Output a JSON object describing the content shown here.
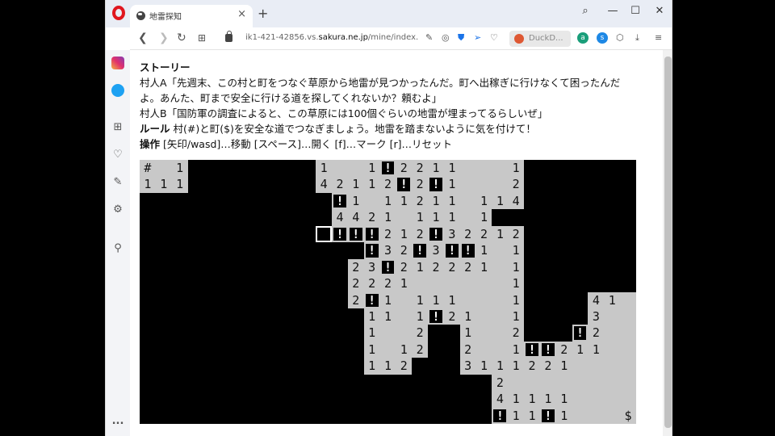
{
  "browser": {
    "tab_title": "地雷探知",
    "tab_close": "×",
    "new_tab": "+",
    "url_prefix": "ik1-421-42856.vs.",
    "url_domain": "sakura.ne.jp",
    "url_path": "/mine/index.htm",
    "search_engine_label": "DuckD...",
    "window_controls": {
      "search": "⌕",
      "minimize": "—",
      "maximize": "☐",
      "close": "✕"
    }
  },
  "sidebar": {
    "icons": [
      "instagram-icon",
      "twitter-icon",
      "apps-icon",
      "heart-icon",
      "pinboard-icon",
      "settings-icon",
      "lightbulb-icon",
      "more-icon"
    ],
    "more_label": "..."
  },
  "page": {
    "story_heading": "ストーリー",
    "story_line1": "村人A「先週末、この村と町をつなぐ草原から地雷が見つかったんだ。町へ出稼ぎに行けなくて困ったんだ",
    "story_line2": "よ。あんた、町まで安全に行ける道を探してくれないか？頼むよ」",
    "story_line3": "村人B「国防軍の調査によると、この草原には100個ぐらいの地雷が埋まってるらしいぜ」",
    "rules_label": "ルール",
    "rules_text": " 村(#)と町($)を安全な道でつなぎましょう。地雷を踏まないように気を付けて！",
    "controls_label": "操作",
    "controls_text": " [矢印/wasd]…移動 [スペース]…開く [f]…マーク [r]…リセット"
  },
  "board": {
    "columns": 31,
    "rows": 16,
    "legend": {
      "village": "#",
      "town": "$",
      "mine_mark": "!"
    },
    "cursor": {
      "row": 4,
      "col": 11
    },
    "cells": [
      {
        "r": 0,
        "c": 0,
        "v": "#"
      },
      {
        "r": 0,
        "c": 1,
        "v": ""
      },
      {
        "r": 0,
        "c": 2,
        "v": "1"
      },
      {
        "r": 1,
        "c": 0,
        "v": "1"
      },
      {
        "r": 1,
        "c": 1,
        "v": "1"
      },
      {
        "r": 1,
        "c": 2,
        "v": "1"
      },
      {
        "r": 0,
        "c": 11,
        "v": "1"
      },
      {
        "r": 0,
        "c": 12,
        "v": ""
      },
      {
        "r": 0,
        "c": 13,
        "v": ""
      },
      {
        "r": 0,
        "c": 14,
        "v": "1"
      },
      {
        "r": 0,
        "c": 15,
        "v": "!"
      },
      {
        "r": 0,
        "c": 16,
        "v": "2"
      },
      {
        "r": 0,
        "c": 17,
        "v": "2"
      },
      {
        "r": 0,
        "c": 18,
        "v": "1"
      },
      {
        "r": 0,
        "c": 19,
        "v": "1"
      },
      {
        "r": 0,
        "c": 20,
        "v": ""
      },
      {
        "r": 0,
        "c": 21,
        "v": ""
      },
      {
        "r": 0,
        "c": 22,
        "v": ""
      },
      {
        "r": 0,
        "c": 23,
        "v": "1"
      },
      {
        "r": 1,
        "c": 11,
        "v": "4"
      },
      {
        "r": 1,
        "c": 12,
        "v": "2"
      },
      {
        "r": 1,
        "c": 13,
        "v": "1"
      },
      {
        "r": 1,
        "c": 14,
        "v": "1"
      },
      {
        "r": 1,
        "c": 15,
        "v": "2"
      },
      {
        "r": 1,
        "c": 16,
        "v": "!"
      },
      {
        "r": 1,
        "c": 17,
        "v": "2"
      },
      {
        "r": 1,
        "c": 18,
        "v": "!"
      },
      {
        "r": 1,
        "c": 19,
        "v": "1"
      },
      {
        "r": 1,
        "c": 20,
        "v": ""
      },
      {
        "r": 1,
        "c": 21,
        "v": ""
      },
      {
        "r": 1,
        "c": 22,
        "v": ""
      },
      {
        "r": 1,
        "c": 23,
        "v": "2"
      },
      {
        "r": 2,
        "c": 12,
        "v": "!"
      },
      {
        "r": 2,
        "c": 13,
        "v": "1"
      },
      {
        "r": 2,
        "c": 14,
        "v": ""
      },
      {
        "r": 2,
        "c": 15,
        "v": "1"
      },
      {
        "r": 2,
        "c": 16,
        "v": "1"
      },
      {
        "r": 2,
        "c": 17,
        "v": "2"
      },
      {
        "r": 2,
        "c": 18,
        "v": "1"
      },
      {
        "r": 2,
        "c": 19,
        "v": "1"
      },
      {
        "r": 2,
        "c": 20,
        "v": ""
      },
      {
        "r": 2,
        "c": 21,
        "v": "1"
      },
      {
        "r": 2,
        "c": 22,
        "v": "1"
      },
      {
        "r": 2,
        "c": 23,
        "v": "4"
      },
      {
        "r": 3,
        "c": 12,
        "v": "4"
      },
      {
        "r": 3,
        "c": 13,
        "v": "4"
      },
      {
        "r": 3,
        "c": 14,
        "v": "2"
      },
      {
        "r": 3,
        "c": 15,
        "v": "1"
      },
      {
        "r": 3,
        "c": 16,
        "v": ""
      },
      {
        "r": 3,
        "c": 17,
        "v": "1"
      },
      {
        "r": 3,
        "c": 18,
        "v": "1"
      },
      {
        "r": 3,
        "c": 19,
        "v": "1"
      },
      {
        "r": 3,
        "c": 20,
        "v": ""
      },
      {
        "r": 3,
        "c": 21,
        "v": "1"
      },
      {
        "r": 4,
        "c": 12,
        "v": "!"
      },
      {
        "r": 4,
        "c": 13,
        "v": "!"
      },
      {
        "r": 4,
        "c": 14,
        "v": "!"
      },
      {
        "r": 4,
        "c": 15,
        "v": "2"
      },
      {
        "r": 4,
        "c": 16,
        "v": "1"
      },
      {
        "r": 4,
        "c": 17,
        "v": "2"
      },
      {
        "r": 4,
        "c": 18,
        "v": "!"
      },
      {
        "r": 4,
        "c": 19,
        "v": "3"
      },
      {
        "r": 4,
        "c": 20,
        "v": "2"
      },
      {
        "r": 4,
        "c": 21,
        "v": "2"
      },
      {
        "r": 4,
        "c": 22,
        "v": "1"
      },
      {
        "r": 4,
        "c": 23,
        "v": "2"
      },
      {
        "r": 5,
        "c": 14,
        "v": "!"
      },
      {
        "r": 5,
        "c": 15,
        "v": "3"
      },
      {
        "r": 5,
        "c": 16,
        "v": "2"
      },
      {
        "r": 5,
        "c": 17,
        "v": "!"
      },
      {
        "r": 5,
        "c": 18,
        "v": "3"
      },
      {
        "r": 5,
        "c": 19,
        "v": "!"
      },
      {
        "r": 5,
        "c": 20,
        "v": "!"
      },
      {
        "r": 5,
        "c": 21,
        "v": "1"
      },
      {
        "r": 5,
        "c": 22,
        "v": ""
      },
      {
        "r": 5,
        "c": 23,
        "v": "1"
      },
      {
        "r": 6,
        "c": 13,
        "v": "2"
      },
      {
        "r": 6,
        "c": 14,
        "v": "3"
      },
      {
        "r": 6,
        "c": 15,
        "v": "!"
      },
      {
        "r": 6,
        "c": 16,
        "v": "2"
      },
      {
        "r": 6,
        "c": 17,
        "v": "1"
      },
      {
        "r": 6,
        "c": 18,
        "v": "2"
      },
      {
        "r": 6,
        "c": 19,
        "v": "2"
      },
      {
        "r": 6,
        "c": 20,
        "v": "2"
      },
      {
        "r": 6,
        "c": 21,
        "v": "1"
      },
      {
        "r": 6,
        "c": 22,
        "v": ""
      },
      {
        "r": 6,
        "c": 23,
        "v": "1"
      },
      {
        "r": 7,
        "c": 13,
        "v": "2"
      },
      {
        "r": 7,
        "c": 14,
        "v": "2"
      },
      {
        "r": 7,
        "c": 15,
        "v": "2"
      },
      {
        "r": 7,
        "c": 16,
        "v": "1"
      },
      {
        "r": 7,
        "c": 17,
        "v": ""
      },
      {
        "r": 7,
        "c": 18,
        "v": ""
      },
      {
        "r": 7,
        "c": 19,
        "v": ""
      },
      {
        "r": 7,
        "c": 20,
        "v": ""
      },
      {
        "r": 7,
        "c": 21,
        "v": ""
      },
      {
        "r": 7,
        "c": 22,
        "v": ""
      },
      {
        "r": 7,
        "c": 23,
        "v": "1"
      },
      {
        "r": 8,
        "c": 13,
        "v": "2"
      },
      {
        "r": 8,
        "c": 14,
        "v": "!"
      },
      {
        "r": 8,
        "c": 15,
        "v": "1"
      },
      {
        "r": 8,
        "c": 16,
        "v": ""
      },
      {
        "r": 8,
        "c": 17,
        "v": "1"
      },
      {
        "r": 8,
        "c": 18,
        "v": "1"
      },
      {
        "r": 8,
        "c": 19,
        "v": "1"
      },
      {
        "r": 8,
        "c": 20,
        "v": ""
      },
      {
        "r": 8,
        "c": 21,
        "v": ""
      },
      {
        "r": 8,
        "c": 22,
        "v": ""
      },
      {
        "r": 8,
        "c": 23,
        "v": "1"
      },
      {
        "r": 8,
        "c": 28,
        "v": "4"
      },
      {
        "r": 8,
        "c": 29,
        "v": "1"
      },
      {
        "r": 8,
        "c": 30,
        "v": ""
      },
      {
        "r": 9,
        "c": 14,
        "v": "1"
      },
      {
        "r": 9,
        "c": 15,
        "v": "1"
      },
      {
        "r": 9,
        "c": 16,
        "v": ""
      },
      {
        "r": 9,
        "c": 17,
        "v": "1"
      },
      {
        "r": 9,
        "c": 18,
        "v": "!"
      },
      {
        "r": 9,
        "c": 19,
        "v": "2"
      },
      {
        "r": 9,
        "c": 20,
        "v": "1"
      },
      {
        "r": 9,
        "c": 21,
        "v": ""
      },
      {
        "r": 9,
        "c": 22,
        "v": ""
      },
      {
        "r": 9,
        "c": 23,
        "v": "1"
      },
      {
        "r": 9,
        "c": 28,
        "v": "3"
      },
      {
        "r": 9,
        "c": 29,
        "v": ""
      },
      {
        "r": 9,
        "c": 30,
        "v": ""
      },
      {
        "r": 10,
        "c": 14,
        "v": "1"
      },
      {
        "r": 10,
        "c": 15,
        "v": ""
      },
      {
        "r": 10,
        "c": 16,
        "v": ""
      },
      {
        "r": 10,
        "c": 17,
        "v": "2"
      },
      {
        "r": 10,
        "c": 20,
        "v": "1"
      },
      {
        "r": 10,
        "c": 21,
        "v": ""
      },
      {
        "r": 10,
        "c": 22,
        "v": ""
      },
      {
        "r": 10,
        "c": 23,
        "v": "2"
      },
      {
        "r": 10,
        "c": 27,
        "v": "!"
      },
      {
        "r": 10,
        "c": 28,
        "v": "2"
      },
      {
        "r": 10,
        "c": 29,
        "v": ""
      },
      {
        "r": 10,
        "c": 30,
        "v": ""
      },
      {
        "r": 11,
        "c": 14,
        "v": "1"
      },
      {
        "r": 11,
        "c": 15,
        "v": ""
      },
      {
        "r": 11,
        "c": 16,
        "v": "1"
      },
      {
        "r": 11,
        "c": 17,
        "v": "2"
      },
      {
        "r": 11,
        "c": 20,
        "v": "2"
      },
      {
        "r": 11,
        "c": 21,
        "v": ""
      },
      {
        "r": 11,
        "c": 22,
        "v": ""
      },
      {
        "r": 11,
        "c": 23,
        "v": "1"
      },
      {
        "r": 11,
        "c": 24,
        "v": "!"
      },
      {
        "r": 11,
        "c": 25,
        "v": "!"
      },
      {
        "r": 11,
        "c": 26,
        "v": "2"
      },
      {
        "r": 11,
        "c": 27,
        "v": "1"
      },
      {
        "r": 11,
        "c": 28,
        "v": "1"
      },
      {
        "r": 11,
        "c": 29,
        "v": ""
      },
      {
        "r": 11,
        "c": 30,
        "v": ""
      },
      {
        "r": 12,
        "c": 14,
        "v": "1"
      },
      {
        "r": 12,
        "c": 15,
        "v": "1"
      },
      {
        "r": 12,
        "c": 16,
        "v": "2"
      },
      {
        "r": 12,
        "c": 20,
        "v": "3"
      },
      {
        "r": 12,
        "c": 21,
        "v": "1"
      },
      {
        "r": 12,
        "c": 22,
        "v": "1"
      },
      {
        "r": 12,
        "c": 23,
        "v": "1"
      },
      {
        "r": 12,
        "c": 24,
        "v": "2"
      },
      {
        "r": 12,
        "c": 25,
        "v": "2"
      },
      {
        "r": 12,
        "c": 26,
        "v": "1"
      },
      {
        "r": 12,
        "c": 27,
        "v": ""
      },
      {
        "r": 12,
        "c": 28,
        "v": ""
      },
      {
        "r": 12,
        "c": 29,
        "v": ""
      },
      {
        "r": 12,
        "c": 30,
        "v": ""
      },
      {
        "r": 13,
        "c": 22,
        "v": "2"
      },
      {
        "r": 13,
        "c": 23,
        "v": ""
      },
      {
        "r": 13,
        "c": 24,
        "v": ""
      },
      {
        "r": 13,
        "c": 25,
        "v": ""
      },
      {
        "r": 13,
        "c": 26,
        "v": ""
      },
      {
        "r": 13,
        "c": 27,
        "v": ""
      },
      {
        "r": 13,
        "c": 28,
        "v": ""
      },
      {
        "r": 13,
        "c": 29,
        "v": ""
      },
      {
        "r": 13,
        "c": 30,
        "v": ""
      },
      {
        "r": 14,
        "c": 22,
        "v": "4"
      },
      {
        "r": 14,
        "c": 23,
        "v": "1"
      },
      {
        "r": 14,
        "c": 24,
        "v": "1"
      },
      {
        "r": 14,
        "c": 25,
        "v": "1"
      },
      {
        "r": 14,
        "c": 26,
        "v": "1"
      },
      {
        "r": 14,
        "c": 27,
        "v": ""
      },
      {
        "r": 14,
        "c": 28,
        "v": ""
      },
      {
        "r": 14,
        "c": 29,
        "v": ""
      },
      {
        "r": 14,
        "c": 30,
        "v": ""
      },
      {
        "r": 15,
        "c": 22,
        "v": "!"
      },
      {
        "r": 15,
        "c": 23,
        "v": "1"
      },
      {
        "r": 15,
        "c": 24,
        "v": "1"
      },
      {
        "r": 15,
        "c": 25,
        "v": "!"
      },
      {
        "r": 15,
        "c": 26,
        "v": "1"
      },
      {
        "r": 15,
        "c": 27,
        "v": ""
      },
      {
        "r": 15,
        "c": 28,
        "v": ""
      },
      {
        "r": 15,
        "c": 29,
        "v": ""
      },
      {
        "r": 15,
        "c": 30,
        "v": "$"
      }
    ]
  }
}
